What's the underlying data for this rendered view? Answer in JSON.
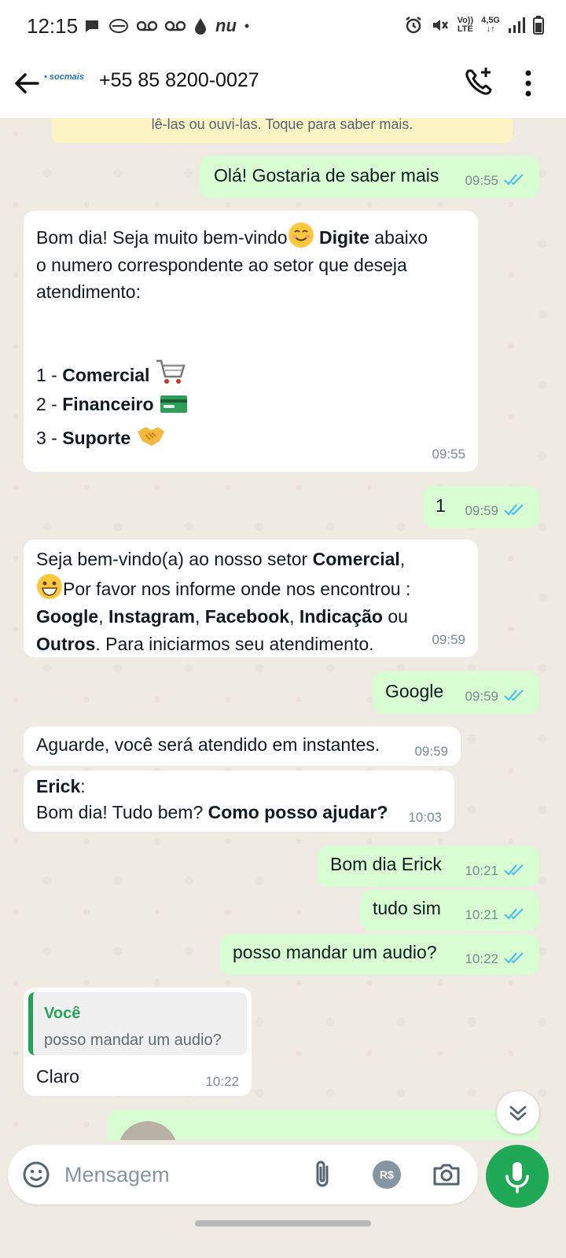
{
  "status_bar": {
    "time": "12:15",
    "left_icons_text": "nu",
    "dot": "•",
    "net_top": "Vo))",
    "net_bottom": "LTE",
    "net2_top": "4,5G",
    "net2_bottom": "↓↑"
  },
  "header": {
    "logo_text": "• socmais",
    "contact": "+55 85 8200-0027"
  },
  "notice": {
    "text": "lê-las ou ouvi-las. Toque para saber mais."
  },
  "messages": {
    "m1": {
      "text": "Olá! Gostaria de saber mais",
      "time": "09:55"
    },
    "m2": {
      "line1_a": "Bom dia! Seja muito bem-vindo",
      "line1_bold": "Digite",
      "line1_b": " abaixo",
      "line2": "o numero correspondente ao setor que deseja",
      "line3": "atendimento:",
      "opt1_num": "1 - ",
      "opt1": "Comercial",
      "opt2_num": "2 - ",
      "opt2": "Financeiro",
      "opt3_num": "3 - ",
      "opt3": "Suporte",
      "time": "09:55"
    },
    "m3": {
      "text": "1",
      "time": "09:59"
    },
    "m4": {
      "l1_a": "Seja bem-vindo(a) ao nosso setor ",
      "l1_bold": "Comercial",
      "l1_b": ",",
      "l2": "Por favor nos informe onde nos encontrou :",
      "l3_b1": "Google",
      "l3_s1": ", ",
      "l3_b2": "Instagram",
      "l3_s2": ", ",
      "l3_b3": "Facebook",
      "l3_s3": ", ",
      "l3_b4": "Indicação",
      "l3_s4": " ou",
      "l4_bold": "Outros",
      "l4_rest": ". Para iniciarmos seu atendimento.",
      "time": "09:59"
    },
    "m5": {
      "text": "Google",
      "time": "09:59"
    },
    "m6": {
      "text": "Aguarde, você será atendido em instantes.",
      "time": "09:59"
    },
    "m7": {
      "author": "Erick",
      "colon": ":",
      "text_a": "Bom dia! Tudo bem? ",
      "text_bold": "Como posso ajudar?",
      "time": "10:03"
    },
    "m8": {
      "text": "Bom dia Erick",
      "time": "10:21"
    },
    "m9": {
      "text": "tudo sim",
      "time": "10:21"
    },
    "m10": {
      "text": "posso mandar um audio?",
      "time": "10:22"
    },
    "m11": {
      "quote_author": "Você",
      "quote_text": "posso mandar um audio?",
      "text": "Claro",
      "time": "10:22"
    }
  },
  "input": {
    "placeholder": "Mensagem",
    "pay_label": "R$"
  },
  "colors": {
    "chat_bg": "#efeae2",
    "outgoing": "#d9fdd3",
    "incoming": "#ffffff",
    "accent_green": "#1fa855",
    "read_tick": "#53bdeb"
  }
}
